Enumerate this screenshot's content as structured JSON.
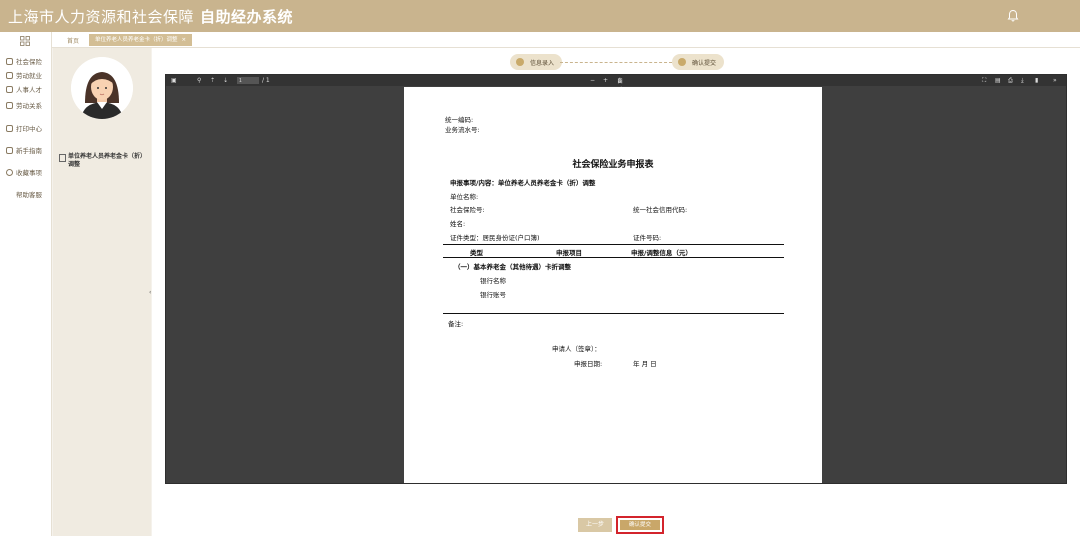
{
  "header": {
    "title_regular": "上海市人力资源和社会保障",
    "title_bold": "自助经办系统",
    "colors": {
      "header_bg": "#c9b48e",
      "accent": "#c9a769",
      "highlight_border": "#d3242c"
    }
  },
  "nav": {
    "grid_icon": "grid-icon",
    "items": [
      {
        "label": "社会保险",
        "icon": "shield-icon"
      },
      {
        "label": "劳动就业",
        "icon": "briefcase-icon"
      },
      {
        "label": "人事人才",
        "icon": "person-icon"
      },
      {
        "label": "劳动关系",
        "icon": "handshake-icon"
      },
      {
        "label": "打印中心",
        "icon": "printer-icon"
      },
      {
        "label": "新手指南",
        "icon": "book-icon"
      },
      {
        "label": "收藏事项",
        "icon": "star-icon"
      },
      {
        "label": "帮助客服",
        "icon": ""
      }
    ]
  },
  "tabs": {
    "home": "首页",
    "active": "单位养老人员养老金卡（折）调整",
    "close": "×"
  },
  "profile": {
    "item_label": "单位养老人员养老金卡（折）调整"
  },
  "steps": {
    "step1": "信息录入",
    "step2": "确认提交"
  },
  "viewer": {
    "page_input": "1",
    "page_total": "/ 1",
    "zoom_minus": "−",
    "zoom_plus": "+",
    "zoom_label": "自动缩放",
    "zoom_caret": "⇕"
  },
  "form": {
    "unified_no": "统一编码:",
    "serial_no": "业务流水号:",
    "title": "社会保险业务申报表",
    "matter": "申报事项/内容：单位养老人员养老金卡（折）调整",
    "unit_name": "单位名称:",
    "si_code": "社会保险号:",
    "credit_code": "统一社会信用代码:",
    "name": "姓名:",
    "id_type": "证件类型：居民身份证(户口簿)",
    "id_no": "证件号码:",
    "col_type": "类型",
    "col_item": "申报项目",
    "col_info": "申报/调整信息（元）",
    "section1": "（一）基本养老金（其他待遇）卡折调整",
    "bank_name": "银行名称",
    "bank_account": "银行账号",
    "remarks": "备注:",
    "applicant": "申请人（签章）：",
    "apply_date": "申报日期:",
    "date_fields": "年    月    日"
  },
  "buttons": {
    "prev": "上一步",
    "confirm": "确认提交"
  }
}
